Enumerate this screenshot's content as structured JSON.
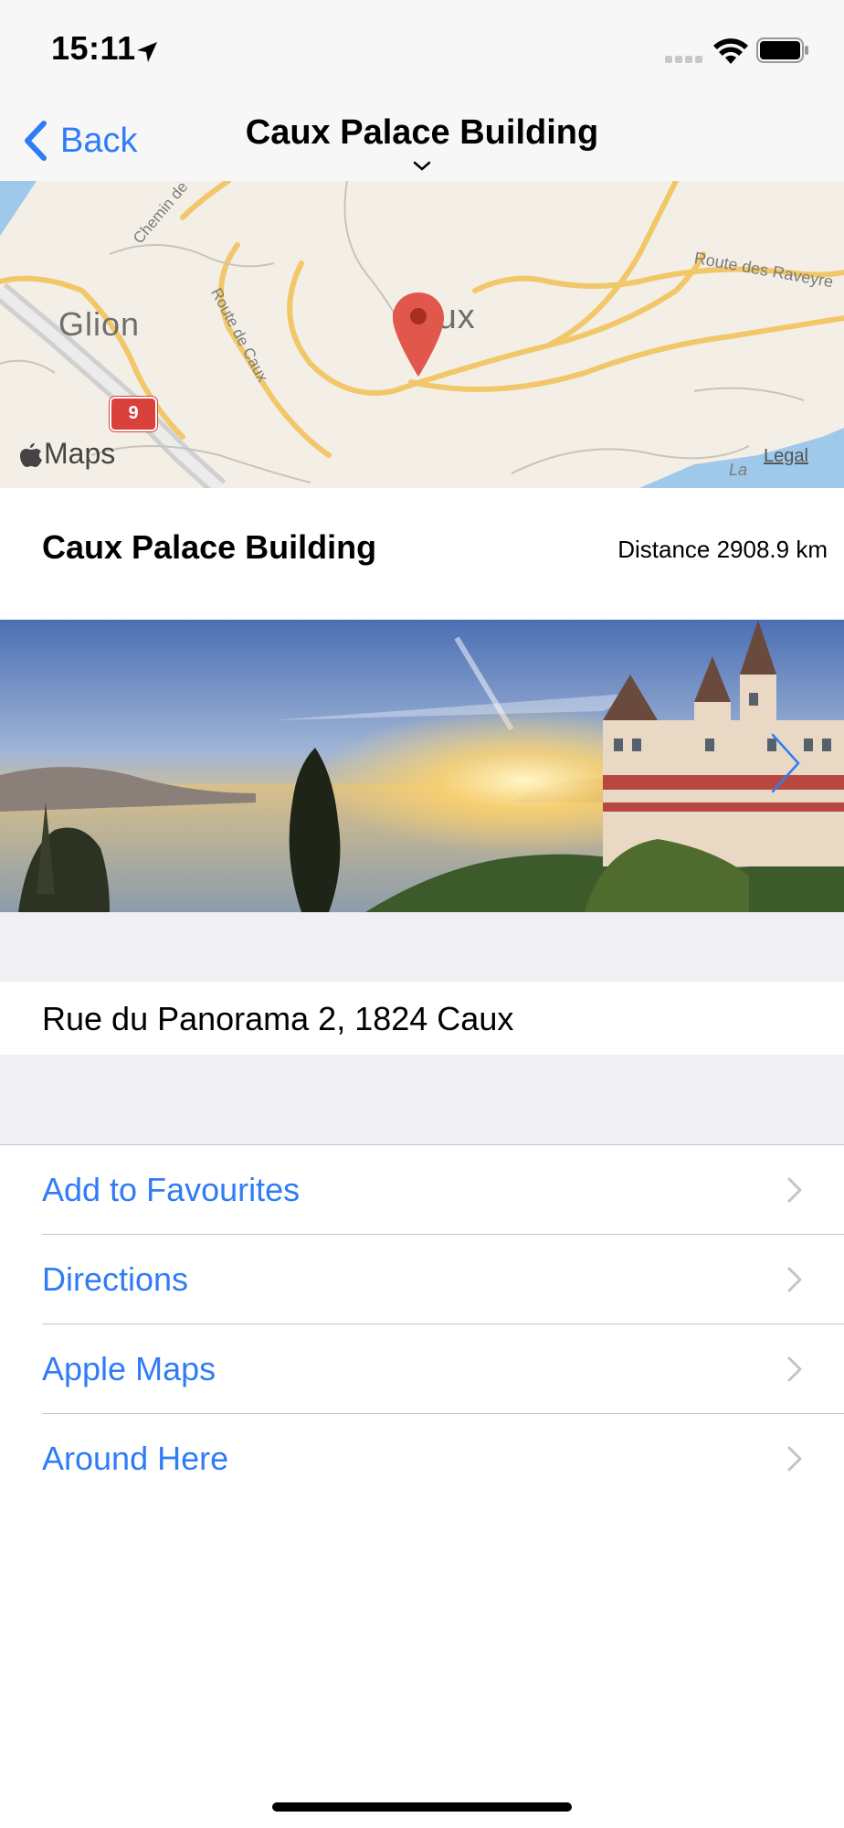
{
  "status_bar": {
    "time": "15:11"
  },
  "nav": {
    "back_label": "Back",
    "title": "Caux Palace Building"
  },
  "map": {
    "labels": {
      "glion": "Glion",
      "caux": "Caux",
      "road_tornay": "Chemin de Torna",
      "road_caux": "Route de Caux",
      "road_raveyre": "Route des Raveyre",
      "la": "La"
    },
    "route_number": "9",
    "maps_brand": "Maps",
    "legal": "Legal"
  },
  "place": {
    "name": "Caux Palace Building",
    "distance": "Distance 2908.9 km"
  },
  "address": "Rue du Panorama 2, 1824 Caux",
  "menu": [
    {
      "label": "Add to Favourites"
    },
    {
      "label": "Directions"
    },
    {
      "label": "Apple Maps"
    },
    {
      "label": "Around Here"
    }
  ],
  "colors": {
    "accent": "#2f7cf6",
    "pin": "#e2574c",
    "group_bg": "#efeff4",
    "separator": "#c8c7cc"
  },
  "icons": [
    "location-arrow-icon",
    "signal-icon",
    "wifi-icon",
    "battery-icon",
    "back-chevron-icon",
    "collapse-chevron-icon",
    "map-pin-icon",
    "apple-logo-icon",
    "photo-next-chevron-icon",
    "row-chevron-icon"
  ]
}
